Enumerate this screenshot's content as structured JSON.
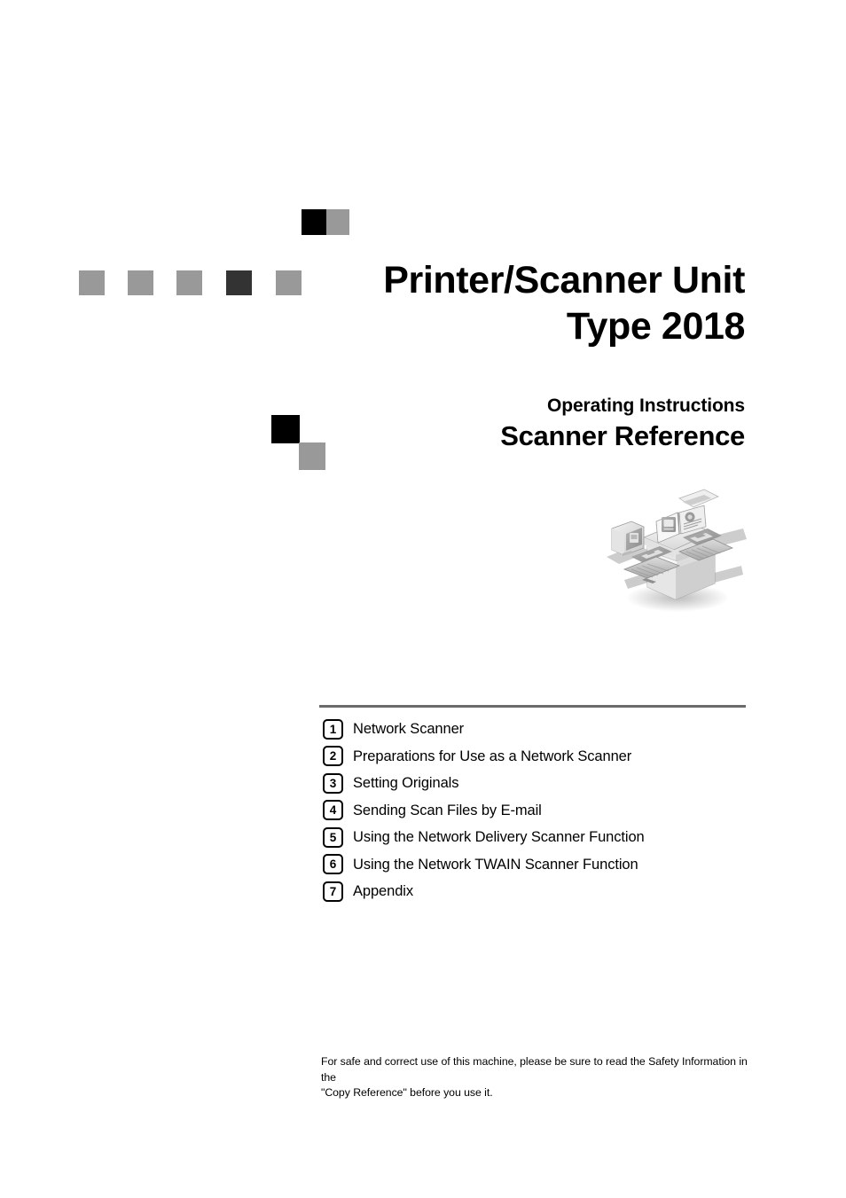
{
  "document": {
    "product_title_line1": "Printer/Scanner Unit",
    "product_title_line2": "Type 2018",
    "manual_kind": "Operating Instructions",
    "manual_title": "Scanner Reference"
  },
  "illustration": {
    "name": "network-scanner-illustration",
    "description": "Copier/scanner connected over a network to two laptops and a desktop monitor"
  },
  "chapters": [
    {
      "number": "1",
      "label": "Network Scanner"
    },
    {
      "number": "2",
      "label": "Preparations for Use as a Network Scanner"
    },
    {
      "number": "3",
      "label": "Setting Originals"
    },
    {
      "number": "4",
      "label": "Sending Scan Files by E-mail"
    },
    {
      "number": "5",
      "label": "Using the Network Delivery Scanner Function"
    },
    {
      "number": "6",
      "label": "Using the Network TWAIN Scanner Function"
    },
    {
      "number": "7",
      "label": "Appendix"
    }
  ],
  "safety_note": {
    "line1": "For safe and correct use of this machine, please be sure to read the Safety Information in the",
    "line2": "\"Copy Reference\" before you use it."
  },
  "colors": {
    "black": "#000000",
    "dark_gray": "#333333",
    "gray": "#999999",
    "rule_gray": "#6b6b6b",
    "page_background": "#ffffff"
  }
}
